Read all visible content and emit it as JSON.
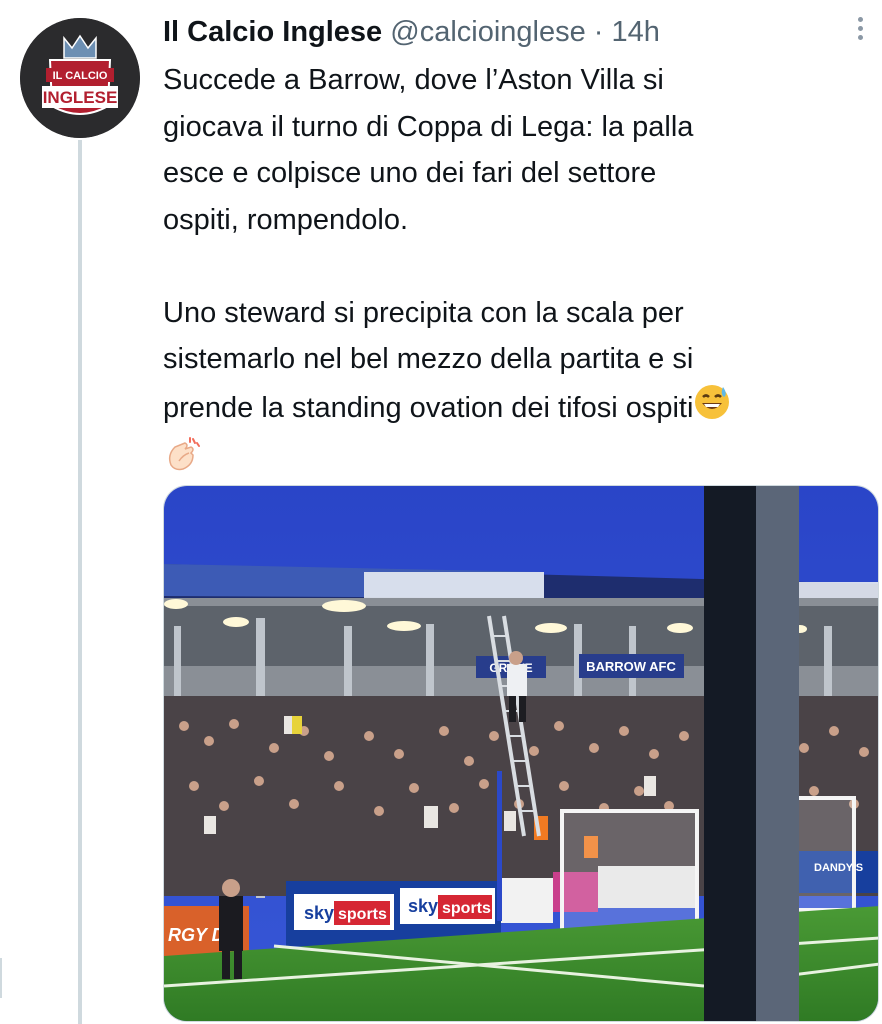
{
  "author": {
    "display_name": "Il Calcio Inglese",
    "handle": "@calcioinglese",
    "separator": "·",
    "time": "14h",
    "avatar_logo_text": [
      "IL CALCIO",
      "INGLESE"
    ]
  },
  "tweet": {
    "paragraph1": "Succede a Barrow, dove l’Aston Villa si\ngiocava il turno di Coppa di Lega: la palla\nesce e colpisce uno dei fari del settore\nospiti, rompendolo.",
    "paragraph2": "Uno steward si precipita con la scala per\nsistemarlo nel bel mezzo della partita e si\nprende la standing ovation dei tifosi ospiti",
    "emoji_end": "grinning-sweat-emoji",
    "emoji_next_line": "clapping-hands-emoji"
  },
  "media": {
    "board_texts": [
      "sky",
      "sports",
      "sky",
      "sports",
      "BARROW AFC",
      "DANDY'S",
      "RGY DR",
      "GROVE"
    ]
  },
  "colors": {
    "text": "#0f1419",
    "secondary": "#536471",
    "thread_line": "#cfd9de",
    "sky": "#2b49c9",
    "pitch": "#3f8a2e"
  }
}
